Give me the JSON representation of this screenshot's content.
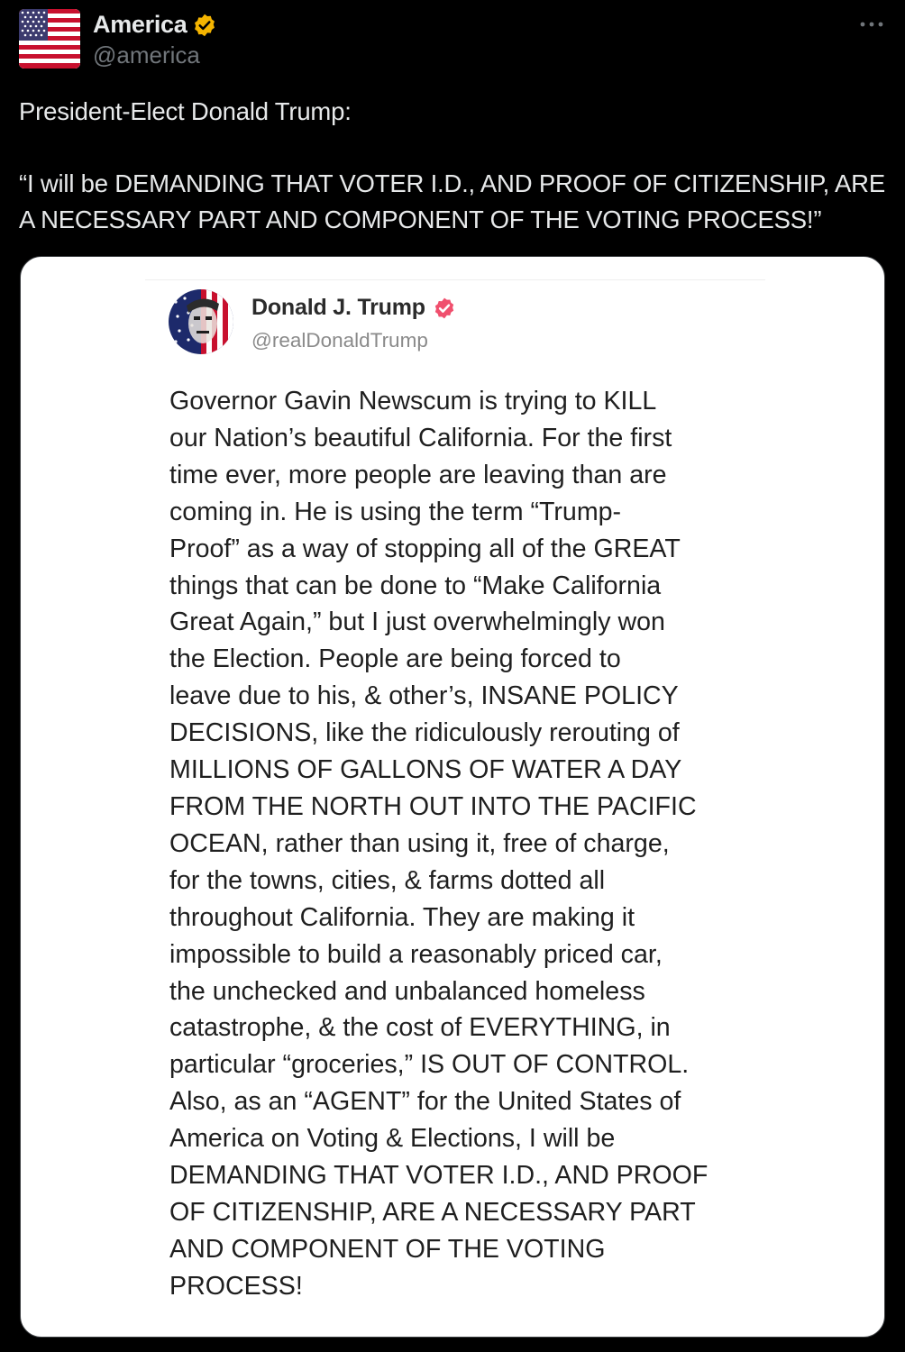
{
  "account": {
    "display_name": "America",
    "handle": "@america",
    "avatar_icon": "us-flag-icon",
    "verified_badge": "gold-verified-icon",
    "verified_color": "#f4b400"
  },
  "menu": {
    "icon": "more-horizontal-icon"
  },
  "tweet": {
    "line1": "President-Elect Donald Trump:",
    "quote_line1": "“I will be DEMANDING THAT VOTER I.D., AND PROOF OF CITIZENSHIP, ARE",
    "quote_line2": "A NECESSARY PART AND COMPONENT OF THE VOTING PROCESS!”"
  },
  "embedded_post": {
    "display_name": "Donald J. Trump",
    "handle": "@realDonaldTrump",
    "verified_badge": "pink-verified-icon",
    "badge_color": "#f0506e",
    "body_lines": [
      "Governor Gavin Newscum is trying to KILL",
      "our Nation’s beautiful California. For the first",
      "time ever, more people are leaving than are",
      "coming in. He is using the term “Trump-",
      "Proof” as a way of stopping all of the GREAT",
      "things that can be done to “Make California",
      "Great Again,” but I just overwhelmingly won",
      "the Election. People are being forced to",
      "leave due to his, & other’s, INSANE POLICY",
      "DECISIONS, like the ridiculously rerouting of",
      "MILLIONS OF GALLONS OF WATER A DAY",
      "FROM THE NORTH OUT INTO THE PACIFIC",
      "OCEAN, rather than using it, free of charge,",
      "for the towns, cities, & farms dotted all",
      "throughout California. They are making it",
      "impossible to build a reasonably priced car,",
      "the unchecked and unbalanced homeless",
      "catastrophe, & the cost of EVERYTHING, in",
      "particular “groceries,” IS OUT OF CONTROL.",
      "Also, as an “AGENT” for the United States of",
      "America on Voting & Elections, I will be",
      "DEMANDING THAT VOTER I.D., AND PROOF",
      "OF CITIZENSHIP, ARE A NECESSARY PART",
      "AND COMPONENT OF THE VOTING",
      "PROCESS!"
    ]
  }
}
